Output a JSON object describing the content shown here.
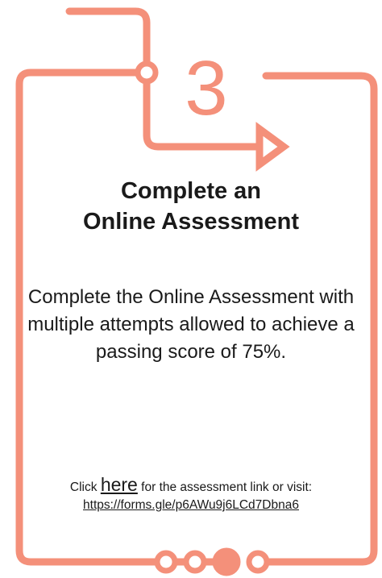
{
  "step": {
    "number": "3"
  },
  "card": {
    "title_line1": "Complete an",
    "title_line2": "Online Assessment",
    "description": "Complete the Online Assessment with multiple attempts allowed to achieve a passing score of 75%.",
    "link_prefix": "Click",
    "link_text": "here",
    "link_suffix": "for the assessment link or visit:",
    "url_text": "https://forms.gle/p6AWu9j6LCd7Dbna6"
  },
  "colors": {
    "accent": "#f4907a",
    "text": "#1a1a1a",
    "background": "#ffffff"
  }
}
